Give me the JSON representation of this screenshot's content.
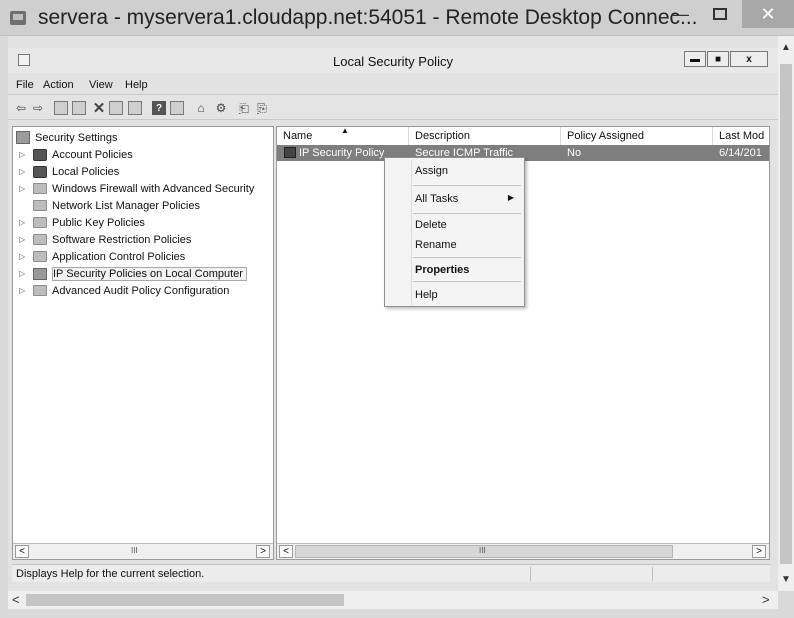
{
  "rdp": {
    "title": "servera - myservera1.cloudapp.net:54051 - Remote Desktop Connec...",
    "min_label": "—",
    "close_label": "✕"
  },
  "window": {
    "title": "Local Security Policy",
    "close_label": "x"
  },
  "menu": [
    "File",
    "Action",
    "View",
    "Help"
  ],
  "tree": {
    "root": "Security Settings",
    "items": [
      {
        "label": "Account Policies",
        "icon": "lock-folder"
      },
      {
        "label": "Local Policies",
        "icon": "lock-folder"
      },
      {
        "label": "Windows Firewall with Advanced Security",
        "icon": "folder"
      },
      {
        "label": "Network List Manager Policies",
        "icon": "folder"
      },
      {
        "label": "Public Key Policies",
        "icon": "folder"
      },
      {
        "label": "Software Restriction Policies",
        "icon": "folder"
      },
      {
        "label": "Application Control Policies",
        "icon": "folder"
      },
      {
        "label": "IP Security Policies on Local Computer",
        "icon": "ipsec"
      },
      {
        "label": "Advanced Audit Policy Configuration",
        "icon": "folder"
      }
    ]
  },
  "list": {
    "columns": [
      "Name",
      "Description",
      "Policy Assigned",
      "Last Mod"
    ],
    "rows": [
      {
        "name": "IP Security Policy",
        "description": "Secure ICMP Traffic",
        "assigned": "No",
        "modified": "6/14/201"
      }
    ]
  },
  "context_menu": {
    "items": [
      "Assign",
      "All Tasks",
      "Delete",
      "Rename",
      "Properties",
      "Help"
    ]
  },
  "scroll": {
    "grip": "III",
    "left": "<",
    "right": ">"
  },
  "status": "Displays Help for the current selection."
}
